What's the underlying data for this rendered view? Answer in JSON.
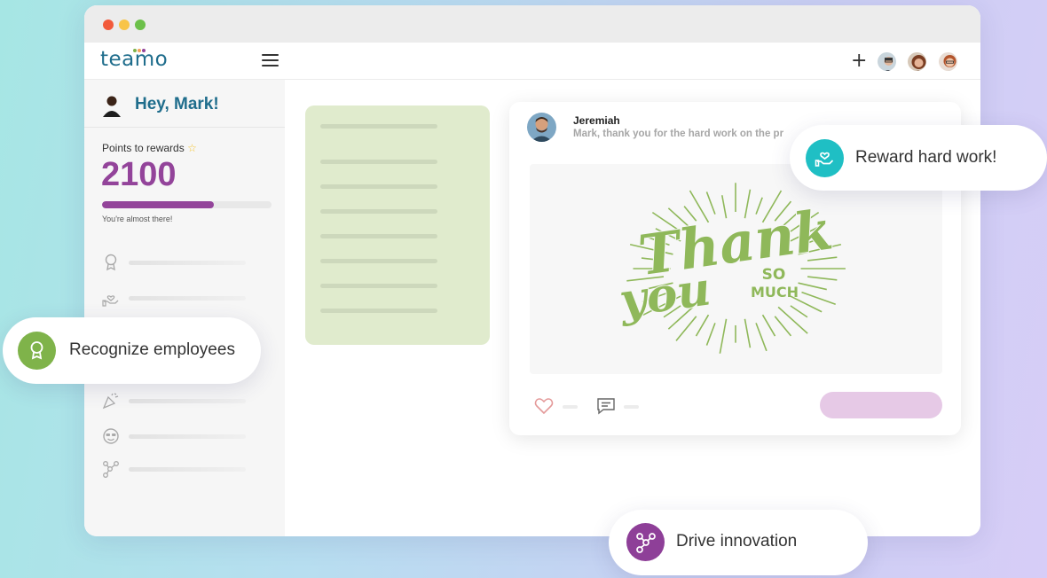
{
  "app": {
    "logo_text": "teamo"
  },
  "topbar": {
    "add_symbol": "+"
  },
  "sidebar": {
    "greeting": "Hey, Mark!",
    "points_label": "Points to rewards",
    "points_value": "2100",
    "progress_fraction": 0.66,
    "progress_caption": "You're almost there!",
    "items": [
      {
        "icon": "award-ribbon-icon"
      },
      {
        "icon": "hand-heart-icon"
      },
      {
        "icon": "party-popper-icon"
      },
      {
        "icon": "smiley-sunglasses-icon"
      },
      {
        "icon": "network-nodes-icon"
      }
    ]
  },
  "post": {
    "author": "Jeremiah",
    "message": "Mark, thank you for the hard work on the pr",
    "image_text": {
      "line1": "Thank",
      "line2": "you",
      "so": "SO",
      "much": "MUCH"
    }
  },
  "callouts": {
    "reward": "Reward hard work!",
    "recognize": "Recognize employees",
    "innovate": "Drive innovation"
  },
  "colors": {
    "brand_blue": "#1f6d8c",
    "brand_purple": "#93449a",
    "teal": "#1fbfc4",
    "green": "#7fb34a",
    "purple_circle": "#8e3f98",
    "thank_you_green": "#8fb85a"
  }
}
